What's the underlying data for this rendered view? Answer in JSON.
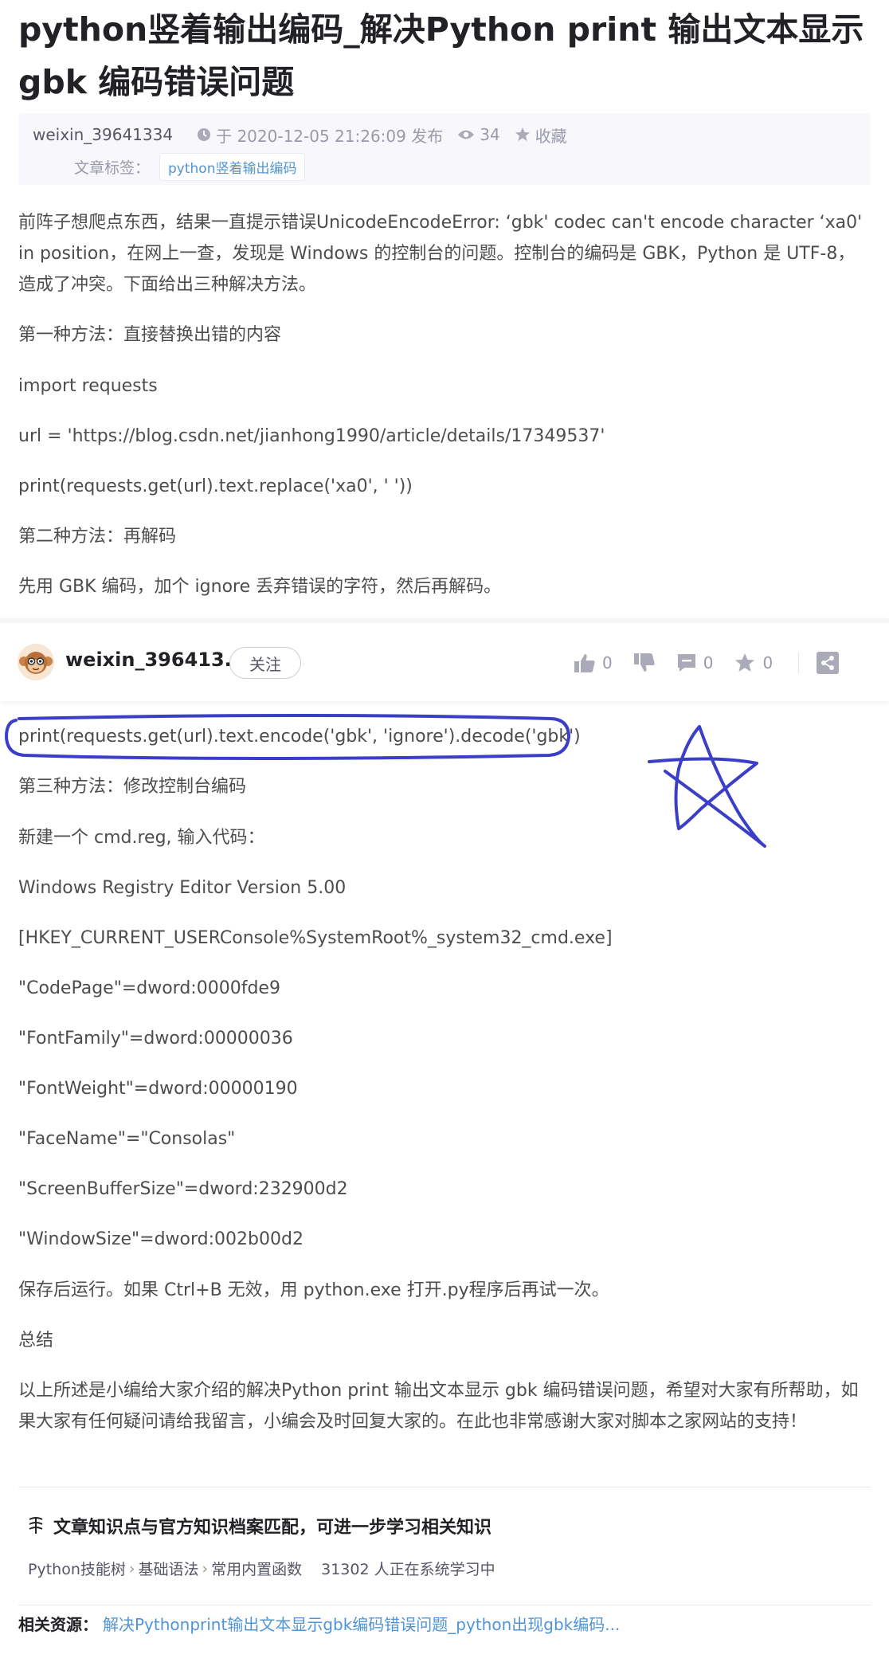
{
  "article": {
    "title": "python竖着输出编码_解决Python print 输出文本显示 gbk 编码错误问题",
    "meta": {
      "author": "weixin_39641334",
      "date": "于 2020-12-05 21:26:09 发布",
      "views": "34",
      "favorite": "收藏",
      "tags_label": "文章标签：",
      "tag": "python竖着输出编码"
    },
    "paragraphs_top": [
      "前阵子想爬点东西，结果一直提示错误UnicodeEncodeError: ‘gbk' codec can't encode character ‘xa0' in position，在网上一查，发现是 Windows 的控制台的问题。控制台的编码是 GBK，Python 是 UTF-8，造成了冲突。下面给出三种解决方法。",
      "第一种方法：直接替换出错的内容",
      "import requests",
      "url = 'https://blog.csdn.net/jianhong1990/article/details/17349537'",
      "print(requests.get(url).text.replace('xa0', ' '))",
      "第二种方法：再解码",
      "先用 GBK 编码，加个 ignore 丢弃错误的字符，然后再解码。"
    ],
    "paragraphs_bottom": [
      "print(requests.get(url).text.encode('gbk', 'ignore').decode('gbk')",
      "第三种方法：修改控制台编码",
      "新建一个 cmd.reg, 输入代码：",
      "Windows Registry Editor Version 5.00",
      "[HKEY_CURRENT_USERConsole%SystemRoot%_system32_cmd.exe]",
      "\"CodePage\"=dword:0000fde9",
      "\"FontFamily\"=dword:00000036",
      "\"FontWeight\"=dword:00000190",
      "\"FaceName\"=\"Consolas\"",
      "\"ScreenBufferSize\"=dword:232900d2",
      "\"WindowSize\"=dword:002b00d2",
      "保存后运行。如果 Ctrl+B 无效，用 python.exe 打开.py程序后再试一次。",
      "总结",
      "以上所述是小编给大家介绍的解决Python print 输出文本显示 gbk 编码错误问题，希望对大家有所帮助，如果大家有任何疑问请给我留言，小编会及时回复大家的。在此也非常感谢大家对脚本之家网站的支持！"
    ]
  },
  "toolbar": {
    "author": "weixin_396413...",
    "follow": "关注",
    "likes": "0",
    "comments": "0",
    "favorites": "0"
  },
  "knowledge": {
    "title": "文章知识点与官方知识档案匹配，可进一步学习相关知识",
    "path": [
      "Python技能树",
      "基础语法",
      "常用内置函数"
    ],
    "learners": "31302 人正在系统学习中"
  },
  "related": {
    "label": "相关资源：",
    "link": "解决Pythonprint输出文本显示gbk编码错误问题_python出现gbk编码..."
  },
  "colors": {
    "link": "#5094d5",
    "annotation": "#3b3fc7",
    "meta_bg": "#f7f7fc"
  }
}
